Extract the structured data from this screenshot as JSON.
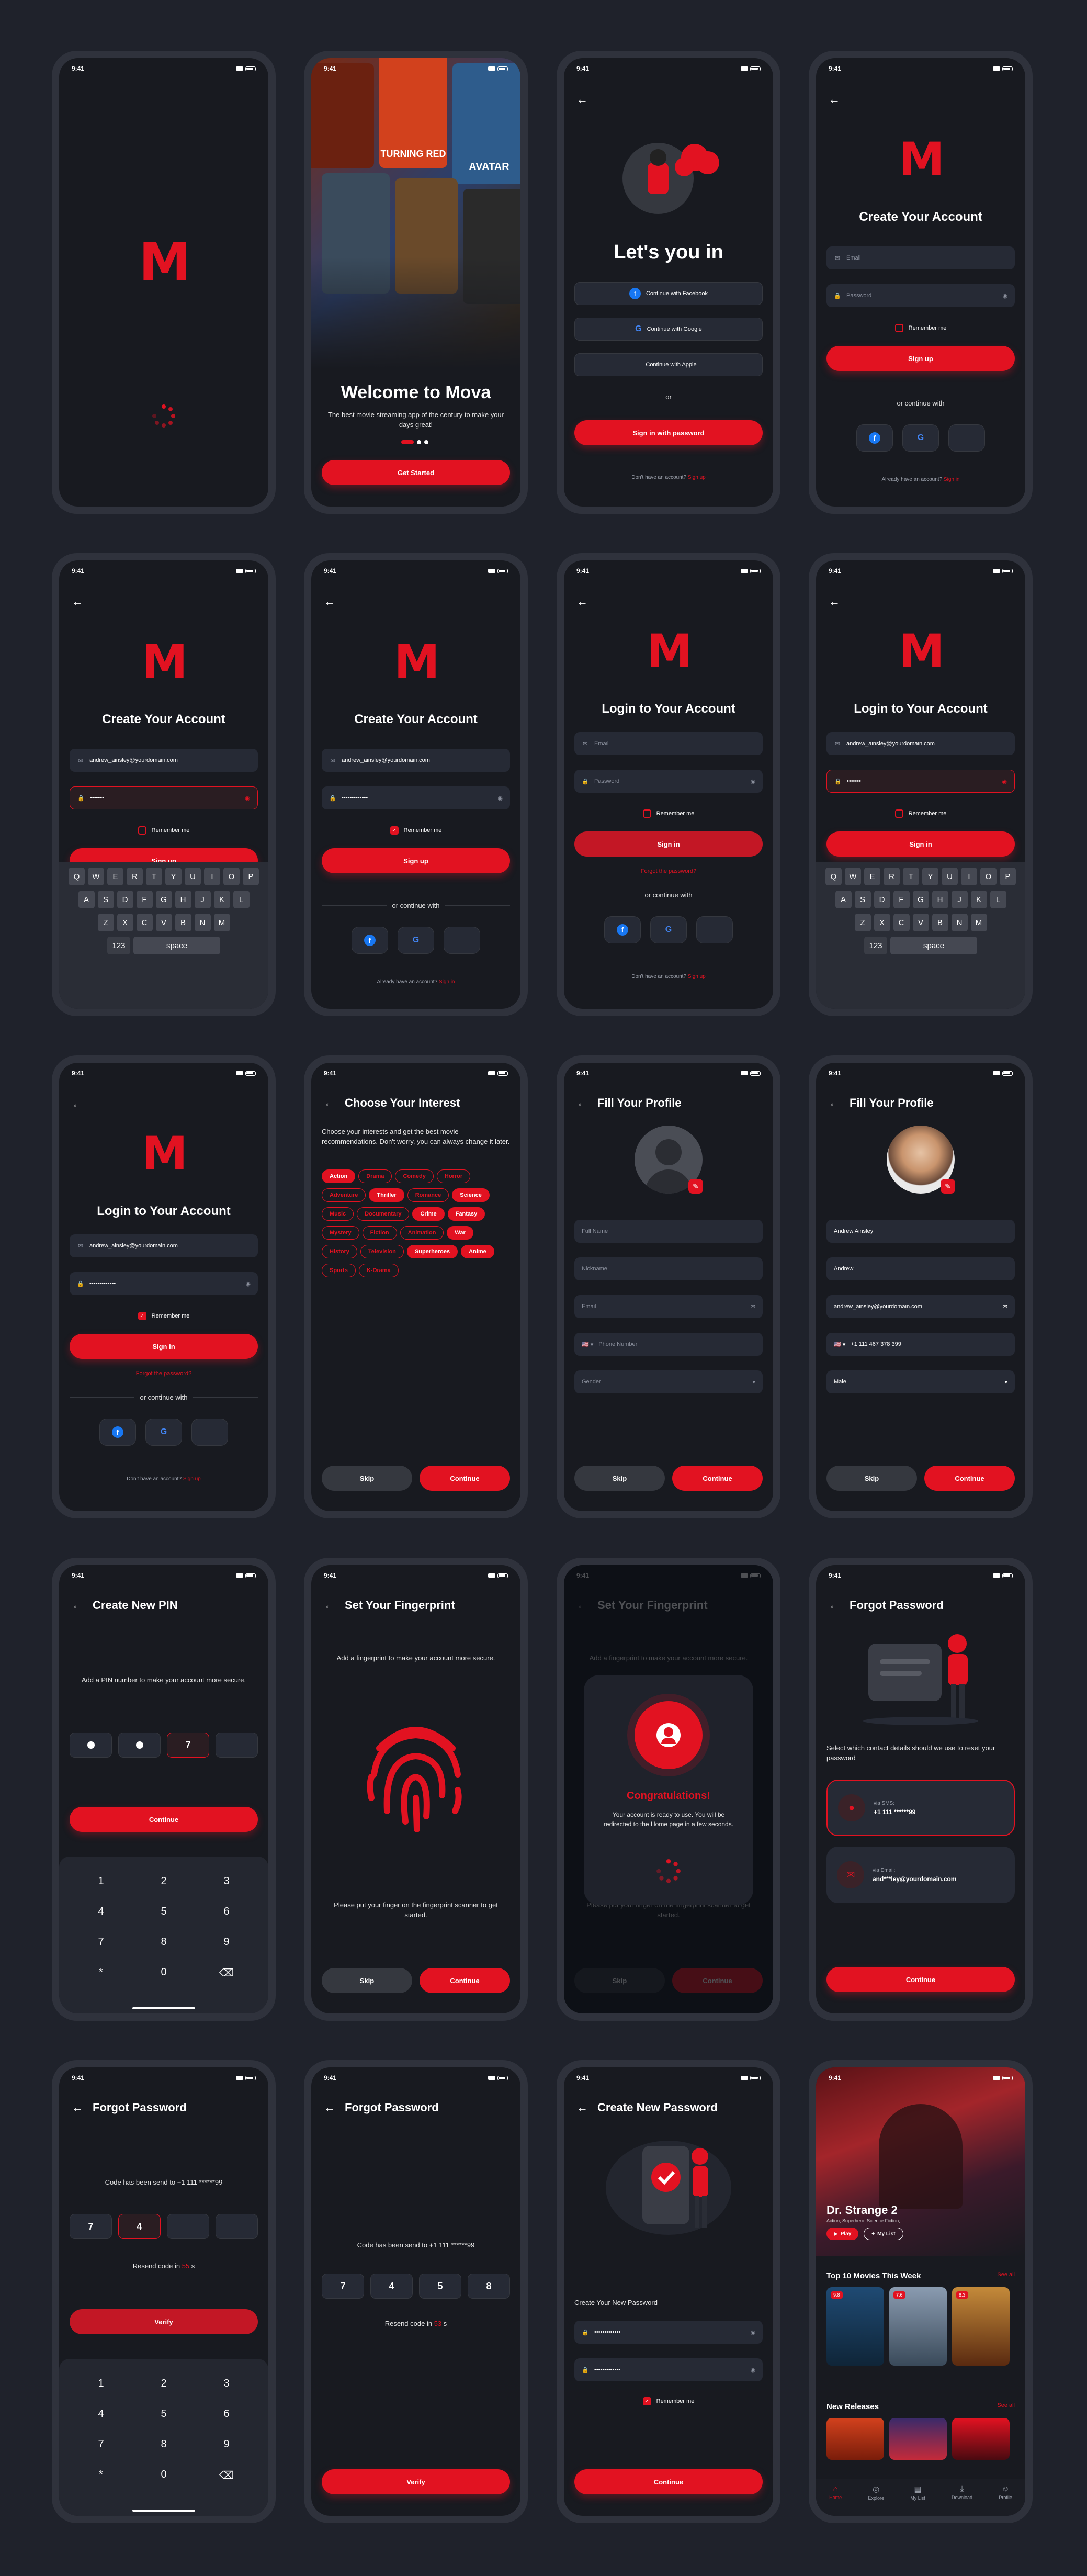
{
  "status_time": "9:41",
  "colors": {
    "accent": "#e21221",
    "bg": "#181a20",
    "frame": "#2f323c",
    "page": "#1f222b"
  },
  "logo_letter": "M",
  "welcome": {
    "title": "Welcome to Mova",
    "subtitle": "The best movie streaming app of the century to make your days great!",
    "button": "Get Started",
    "poster_titles": [
      "TURNING RED",
      "AVATAR"
    ]
  },
  "letsin": {
    "title": "Let's you in",
    "facebook": "Continue with Facebook",
    "google": "Continue with Google",
    "apple": "Continue with Apple",
    "or": "or",
    "password_btn": "Sign in with password",
    "no_account": "Don't have an account?",
    "signup": "Sign up"
  },
  "signup": {
    "title": "Create Your Account",
    "email_ph": "Email",
    "password_ph": "Password",
    "remember": "Remember me",
    "button": "Sign up",
    "continue_with": "or continue with",
    "have_account": "Already have an account?",
    "signin": "Sign in",
    "email_val": "andrew_ainsley@yourdomain.com",
    "pw_short": "•••••••",
    "pw_long": "•••••••••••••"
  },
  "login": {
    "title": "Login to Your Account",
    "button": "Sign in",
    "forgot": "Forgot the password?",
    "no_account": "Don't have an account?",
    "signup": "Sign up"
  },
  "keyboard": {
    "row1": [
      "Q",
      "W",
      "E",
      "R",
      "T",
      "Y",
      "U",
      "I",
      "O",
      "P"
    ],
    "row2": [
      "A",
      "S",
      "D",
      "F",
      "G",
      "H",
      "J",
      "K",
      "L"
    ],
    "row3": [
      "Z",
      "X",
      "C",
      "V",
      "B",
      "N",
      "M"
    ],
    "num": "123",
    "space": "space"
  },
  "interest": {
    "title": "Choose Your Interest",
    "desc": "Choose your interests and get the best movie recommendations. Don't worry, you can always change it later.",
    "chips": [
      {
        "label": "Action",
        "on": true
      },
      {
        "label": "Drama",
        "on": false
      },
      {
        "label": "Comedy",
        "on": false
      },
      {
        "label": "Horror",
        "on": false
      },
      {
        "label": "Adventure",
        "on": false
      },
      {
        "label": "Thriller",
        "on": true
      },
      {
        "label": "Romance",
        "on": false
      },
      {
        "label": "Science",
        "on": true
      },
      {
        "label": "Music",
        "on": false
      },
      {
        "label": "Documentary",
        "on": false
      },
      {
        "label": "Crime",
        "on": true
      },
      {
        "label": "Fantasy",
        "on": true
      },
      {
        "label": "Mystery",
        "on": false
      },
      {
        "label": "Fiction",
        "on": false
      },
      {
        "label": "Animation",
        "on": false
      },
      {
        "label": "War",
        "on": true
      },
      {
        "label": "History",
        "on": false
      },
      {
        "label": "Television",
        "on": false
      },
      {
        "label": "Superheroes",
        "on": true
      },
      {
        "label": "Anime",
        "on": true
      },
      {
        "label": "Sports",
        "on": false
      },
      {
        "label": "K-Drama",
        "on": false
      }
    ],
    "skip": "Skip",
    "continue": "Continue"
  },
  "profile": {
    "title": "Fill Your Profile",
    "fullname_ph": "Full Name",
    "nickname_ph": "Nickname",
    "email_ph": "Email",
    "phone_ph": "Phone Number",
    "gender_ph": "Gender",
    "fullname": "Andrew Ainsley",
    "nickname": "Andrew",
    "email": "andrew_ainsley@yourdomain.com",
    "phone": "+1 111 467 378 399",
    "gender": "Male"
  },
  "pin": {
    "title": "Create New PIN",
    "desc": "Add a PIN number to make your account more secure.",
    "digit": "7",
    "button": "Continue",
    "keys": [
      "1",
      "2",
      "3",
      "4",
      "5",
      "6",
      "7",
      "8",
      "9",
      "*",
      "0"
    ]
  },
  "finger": {
    "title": "Set Your Fingerprint",
    "desc": "Add a fingerprint to make your account more secure.",
    "hint": "Please put your finger on the fingerprint scanner to get started.",
    "skip": "Skip",
    "continue": "Continue",
    "congrats": "Congratulations!",
    "congrats_desc": "Your account is ready to use. You will be redirected to the Home page in a few seconds."
  },
  "forgot": {
    "title": "Forgot Password",
    "desc": "Select which contact details should we use to reset your password",
    "sms_label": "via SMS:",
    "sms_val": "+1 111 ******99",
    "email_label": "via Email:",
    "email_val": "and***ley@yourdomain.com",
    "button": "Continue",
    "code_sent": "Code has been send to +1 111 ******99",
    "resend_pre": "Resend code in",
    "resend_num1": "55",
    "resend_num2": "53",
    "resend_post": "s",
    "otp1": [
      "7",
      "4",
      "",
      ""
    ],
    "otp2": [
      "7",
      "4",
      "5",
      "8"
    ],
    "verify": "Verify"
  },
  "newpw": {
    "title": "Create New Password",
    "label": "Create Your New Password",
    "pw": "•••••••••••••",
    "remember": "Remember me",
    "button": "Continue"
  },
  "home": {
    "hero_title": "Dr. Strange 2",
    "hero_genre": "Action, Superhero, Science Fiction, ...",
    "play": "Play",
    "mylist": "My List",
    "top10": "Top 10 Movies This Week",
    "new_releases": "New Releases",
    "see_all": "See all",
    "ratings": [
      "9.8",
      "7.6",
      "8.3"
    ],
    "tabs": [
      "Home",
      "Explore",
      "My List",
      "Download",
      "Profile"
    ]
  }
}
